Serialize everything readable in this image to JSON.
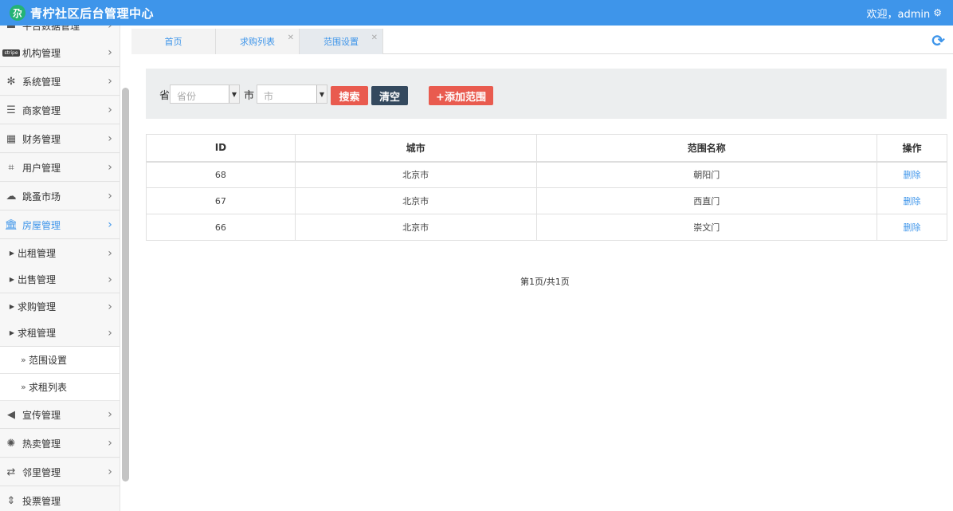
{
  "header": {
    "title": "青柠社区后台管理中心",
    "logo_glyph": "尕",
    "welcome": "欢迎，admin",
    "settings_icon": "gear-icon"
  },
  "sidebar": {
    "items": [
      {
        "label": "平台数据管理",
        "icon": "monitor-icon"
      },
      {
        "label": "机构管理",
        "icon": "stripe-icon"
      },
      {
        "label": "系统管理",
        "icon": "yelp-icon"
      },
      {
        "label": "商家管理",
        "icon": "bars-icon"
      },
      {
        "label": "财务管理",
        "icon": "calculator-icon"
      },
      {
        "label": "用户管理",
        "icon": "crop-icon"
      },
      {
        "label": "跳蚤市场",
        "icon": "cloud-icon"
      },
      {
        "label": "房屋管理",
        "icon": "bank-icon"
      }
    ],
    "sub_items": [
      "出租管理",
      "出售管理",
      "求购管理",
      "求租管理"
    ],
    "leaf_items": [
      "范围设置",
      "求租列表"
    ],
    "bottom_items": [
      {
        "label": "宣传管理",
        "icon": "volume-icon"
      },
      {
        "label": "热卖管理",
        "icon": "sun-icon"
      },
      {
        "label": "邻里管理",
        "icon": "retweet-icon"
      },
      {
        "label": "投票管理",
        "icon": "sort-icon"
      }
    ]
  },
  "tabs": [
    {
      "label": "首页"
    },
    {
      "label": "求购列表"
    },
    {
      "label": "范围设置"
    }
  ],
  "filter": {
    "province_label": "省",
    "province_placeholder": "省份",
    "city_label": "市",
    "city_placeholder": "市",
    "search_label": "搜索",
    "clear_label": "清空",
    "add_label": "+添加范围"
  },
  "table": {
    "headers": [
      "ID",
      "城市",
      "范围名称",
      "操作"
    ],
    "rows": [
      {
        "id": "68",
        "city": "北京市",
        "name": "朝阳门",
        "action": "删除"
      },
      {
        "id": "67",
        "city": "北京市",
        "name": "西直门",
        "action": "删除"
      },
      {
        "id": "66",
        "city": "北京市",
        "name": "崇文门",
        "action": "删除"
      }
    ]
  },
  "pagination": "第1页/共1页",
  "colors": {
    "primary": "#3e95ea",
    "danger": "#e95b4f",
    "dark": "#34495e",
    "logo": "#24b374"
  }
}
